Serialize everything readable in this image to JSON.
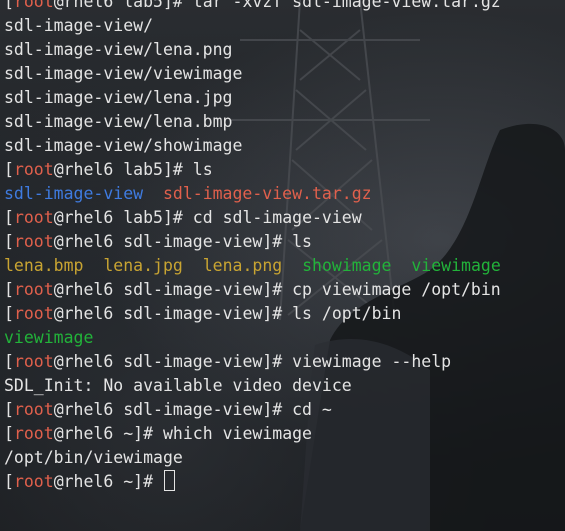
{
  "terminal": {
    "prompt_user": "root",
    "clipped_first_line_left": "[",
    "clipped_first_line_highlight": "root",
    "clipped_first_line_rest": "@rhel6 lab5]# tar -xvzf sdl-image-view.tar.gz",
    "lines": [
      {
        "type": "prompt",
        "host": "rhel6",
        "dir": "lab5",
        "command": "tar -xvzf sdl-image-view.tar.gz"
      },
      {
        "type": "output",
        "tokens": [
          {
            "text": "sdl-image-view/",
            "color": "#e4e4e4"
          }
        ]
      },
      {
        "type": "output",
        "tokens": [
          {
            "text": "sdl-image-view/lena.png",
            "color": "#e4e4e4"
          }
        ]
      },
      {
        "type": "output",
        "tokens": [
          {
            "text": "sdl-image-view/viewimage",
            "color": "#e4e4e4"
          }
        ]
      },
      {
        "type": "output",
        "tokens": [
          {
            "text": "sdl-image-view/lena.jpg",
            "color": "#e4e4e4"
          }
        ]
      },
      {
        "type": "output",
        "tokens": [
          {
            "text": "sdl-image-view/lena.bmp",
            "color": "#e4e4e4"
          }
        ]
      },
      {
        "type": "output",
        "tokens": [
          {
            "text": "sdl-image-view/showimage",
            "color": "#e4e4e4"
          }
        ]
      },
      {
        "type": "prompt",
        "host": "rhel6",
        "dir": "lab5",
        "command": "ls"
      },
      {
        "type": "output",
        "tokens": [
          {
            "text": "sdl-image-view",
            "color": "#3f7be0"
          },
          {
            "text": "  ",
            "color": "#e4e4e4"
          },
          {
            "text": "sdl-image-view.tar.gz",
            "color": "#e0604c"
          }
        ]
      },
      {
        "type": "prompt",
        "host": "rhel6",
        "dir": "lab5",
        "command": "cd sdl-image-view"
      },
      {
        "type": "prompt",
        "host": "rhel6",
        "dir": "sdl-image-view",
        "command": "ls"
      },
      {
        "type": "output",
        "tokens": [
          {
            "text": "lena.bmp",
            "color": "#c8a432"
          },
          {
            "text": "  ",
            "color": "#e4e4e4"
          },
          {
            "text": "lena.jpg",
            "color": "#c8a432"
          },
          {
            "text": "  ",
            "color": "#e4e4e4"
          },
          {
            "text": "lena.png",
            "color": "#c8a432"
          },
          {
            "text": "  ",
            "color": "#e4e4e4"
          },
          {
            "text": "showimage",
            "color": "#22b33a"
          },
          {
            "text": "  ",
            "color": "#e4e4e4"
          },
          {
            "text": "viewimage",
            "color": "#22b33a"
          }
        ]
      },
      {
        "type": "prompt",
        "host": "rhel6",
        "dir": "sdl-image-view",
        "command": "cp viewimage /opt/bin"
      },
      {
        "type": "prompt",
        "host": "rhel6",
        "dir": "sdl-image-view",
        "command": "ls /opt/bin"
      },
      {
        "type": "output",
        "tokens": [
          {
            "text": "viewimage",
            "color": "#22b33a"
          }
        ]
      },
      {
        "type": "prompt",
        "host": "rhel6",
        "dir": "sdl-image-view",
        "command": "viewimage --help"
      },
      {
        "type": "output",
        "tokens": [
          {
            "text": "SDL_Init: No available video device",
            "color": "#e4e4e4"
          }
        ]
      },
      {
        "type": "prompt",
        "host": "rhel6",
        "dir": "sdl-image-view",
        "command": "cd ~"
      },
      {
        "type": "prompt",
        "host": "rhel6",
        "dir": "~",
        "command": "which viewimage"
      },
      {
        "type": "output",
        "tokens": [
          {
            "text": "/opt/bin/viewimage",
            "color": "#e4e4e4"
          }
        ]
      },
      {
        "type": "prompt",
        "host": "rhel6",
        "dir": "~",
        "command": "",
        "cursor": true
      }
    ]
  },
  "colors": {
    "text": "#e4e4e4",
    "prompt_user": "#e0604c",
    "directory": "#3f7be0",
    "archive": "#e0604c",
    "image_file": "#c8a432",
    "executable": "#22b33a"
  }
}
